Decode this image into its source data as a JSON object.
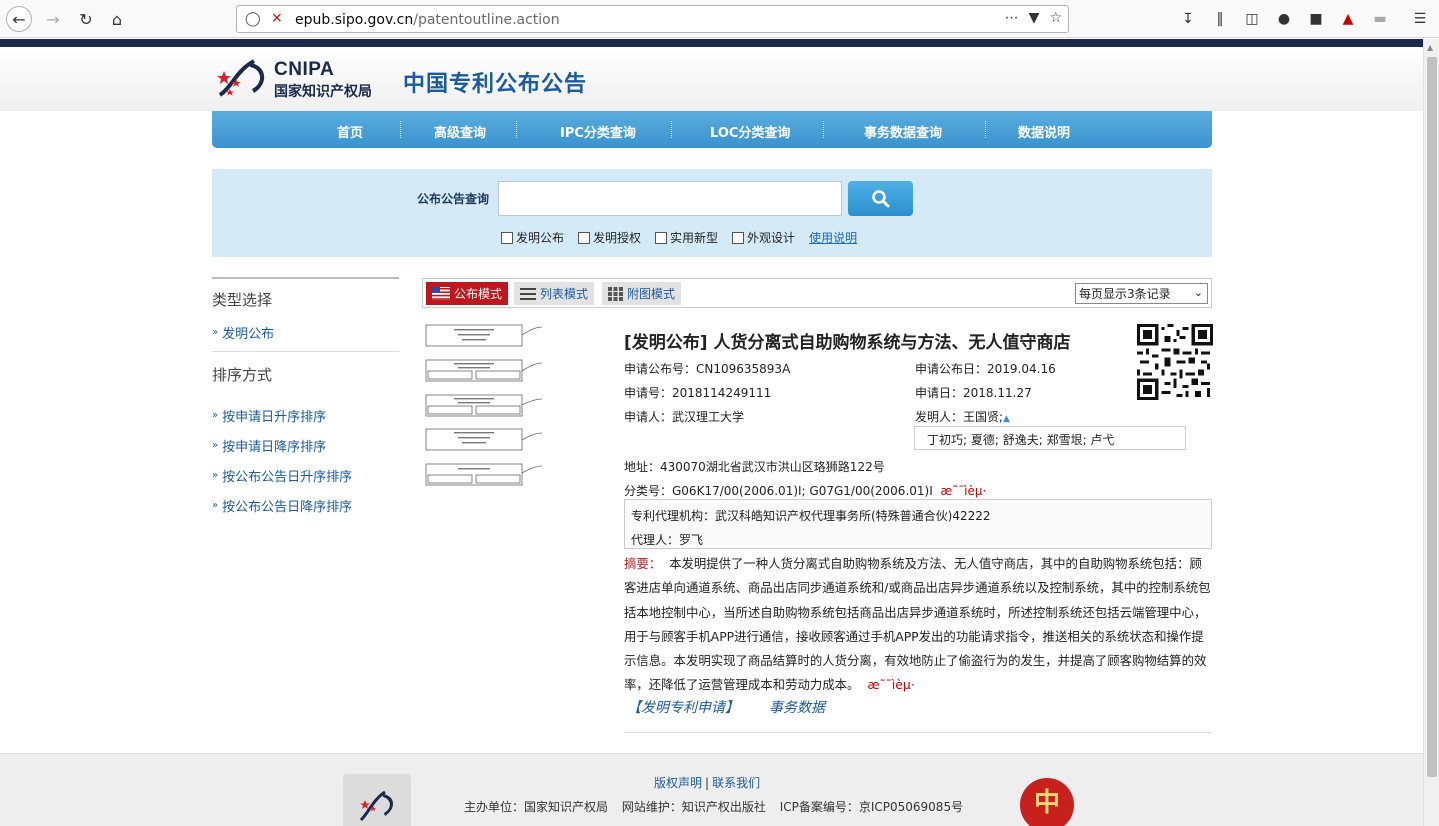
{
  "browser": {
    "url_host": "epub.sipo.gov.cn",
    "url_path": "/patentoutline.action"
  },
  "header": {
    "logo_en": "CNIPA",
    "logo_cn": "国家知识产权局",
    "site_title": "中国专利公布公告"
  },
  "nav": {
    "items": [
      "首页",
      "高级查询",
      "IPC分类查询",
      "LOC分类查询",
      "事务数据查询",
      "数据说明"
    ]
  },
  "search": {
    "label": "公布公告查询",
    "value": "",
    "checkboxes": [
      "发明公布",
      "发明授权",
      "实用新型",
      "外观设计"
    ],
    "help_link": "使用说明"
  },
  "sidebar": {
    "type_section": "类型选择",
    "type_items": [
      "发明公布"
    ],
    "sort_section": "排序方式",
    "sort_items": [
      "按申请日升序排序",
      "按申请日降序排序",
      "按公布公告日升序排序",
      "按公布公告日降序排序"
    ]
  },
  "modes": {
    "publish": "公布模式",
    "list": "列表模式",
    "figure": "附图模式",
    "per_page": "每页显示3条记录"
  },
  "record": {
    "title": "[发明公布] 人货分离式自助购物系统与方法、无人值守商店",
    "pub_no": "申请公布号：CN109635893A",
    "pub_date": "申请公布日：2019.04.16",
    "app_no": "申请号：2018114249111",
    "app_date": "申请日：2018.11.27",
    "applicant": "申请人：武汉理工大学",
    "inventor": "发明人：王国贤;",
    "inventors_more": "丁初巧; 夏德; 舒逸夫; 郑雪垠; 卢弋",
    "address": "地址：430070湖北省武汉市洪山区珞狮路122号",
    "classification": "分类号：G06K17/00(2006.01)I; G07G1/00(2006.01)I",
    "garble1": "æ˜¯ìèµ·",
    "agency": "专利代理机构：武汉科皓知识产权代理事务所(特殊普通合伙)42222",
    "agent": "代理人：罗飞",
    "abstract_label": "摘要：",
    "abstract": "本发明提供了一种人货分离式自助购物系统及方法、无人值守商店，其中的自助购物系统包括：顾客进店单向通道系统、商品出店同步通道系统和/或商品出店异步通道系统以及控制系统，其中的控制系统包括本地控制中心，当所述自助购物系统包括商品出店异步通道系统时，所述控制系统还包括云端管理中心，用于与顾客手机APP进行通信，接收顾客通过手机APP发出的功能请求指令，推送相关的系统状态和操作提示信息。本发明实现了商品结算时的人货分离，有效地防止了偷盗行为的发生，并提高了顾客购物结算的效率，还降低了运营管理成本和劳动力成本。",
    "garble2": "æ˜¯ìèµ·",
    "link_apply": "【发明专利申请】",
    "link_affairs": "事务数据"
  },
  "footer": {
    "copyright": "版权声明",
    "contact": "联系我们",
    "host": "主办单位：国家知识产权局",
    "maintain": "网站维护：知识产权出版社",
    "icp": "ICP备案编号：京ICP05069085号",
    "badge": "中"
  }
}
